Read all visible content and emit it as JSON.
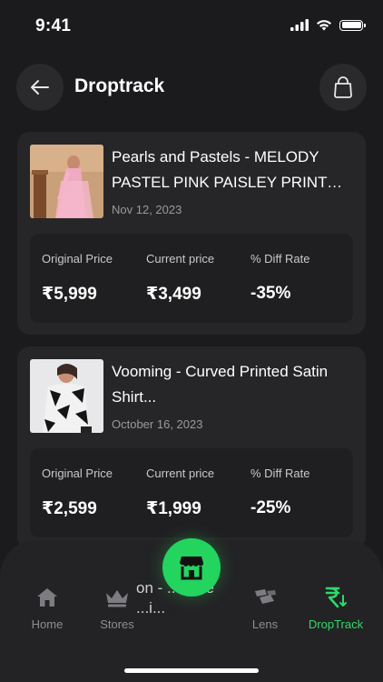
{
  "status_bar": {
    "time": "9:41"
  },
  "header": {
    "title": "Droptrack"
  },
  "products": [
    {
      "title": "Pearls and Pastels - MELODY PASTEL PINK PAISLEY PRINT CO...",
      "date": "Nov 12, 2023",
      "labels": {
        "original": "Original Price",
        "current": "Current price",
        "diff": "% Diff Rate"
      },
      "original_price": "₹5,999",
      "current_price": "₹3,499",
      "diff_rate": "-35%"
    },
    {
      "title": "Vooming - Curved Printed Satin Shirt...",
      "date": "October 16, 2023",
      "labels": {
        "original": "Original Price",
        "current": "Current price",
        "diff": "% Diff Rate"
      },
      "original_price": "₹2,599",
      "current_price": "₹1,999",
      "diff_rate": "-25%"
    }
  ],
  "peek": {
    "text": "on - ...rs Le",
    "text2": "...i..."
  },
  "nav": {
    "home": "Home",
    "stores": "Stores",
    "lens": "Lens",
    "droptrack": "DropTrack"
  },
  "colors": {
    "accent": "#23d45f",
    "background": "#1b1b1d",
    "card": "#262628"
  },
  "icons": [
    "back-arrow-icon",
    "shopping-bag-icon",
    "home-icon",
    "crown-icon",
    "lens-icon",
    "rupee-down-icon",
    "storefront-icon"
  ]
}
